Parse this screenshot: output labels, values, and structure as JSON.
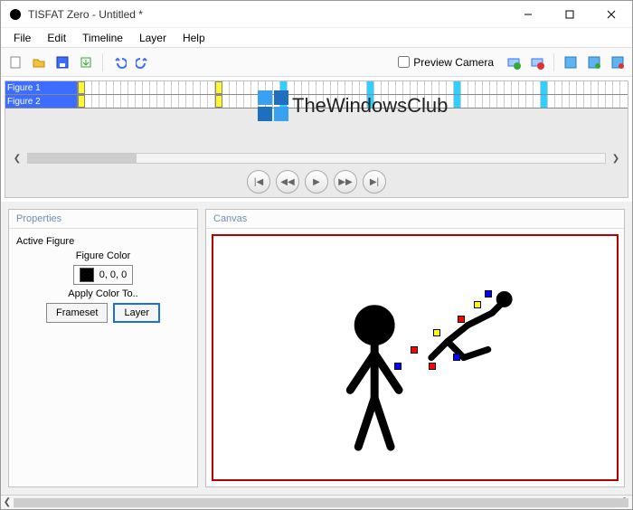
{
  "window": {
    "title": "TISFAT Zero - Untitled *"
  },
  "menu": {
    "file": "File",
    "edit": "Edit",
    "timeline": "Timeline",
    "layer": "Layer",
    "help": "Help"
  },
  "toolbar": {
    "preview_camera_label": "Preview Camera"
  },
  "timeline": {
    "figures": [
      "Figure 1",
      "Figure 2"
    ]
  },
  "watermark": {
    "text": "TheWindowsClub"
  },
  "properties": {
    "panel_title": "Properties",
    "active_figure_label": "Active Figure",
    "figure_color_label": "Figure Color",
    "color_value": "0, 0, 0",
    "apply_label": "Apply Color To..",
    "frameset_btn": "Frameset",
    "layer_btn": "Layer"
  },
  "canvas": {
    "panel_title": "Canvas"
  }
}
